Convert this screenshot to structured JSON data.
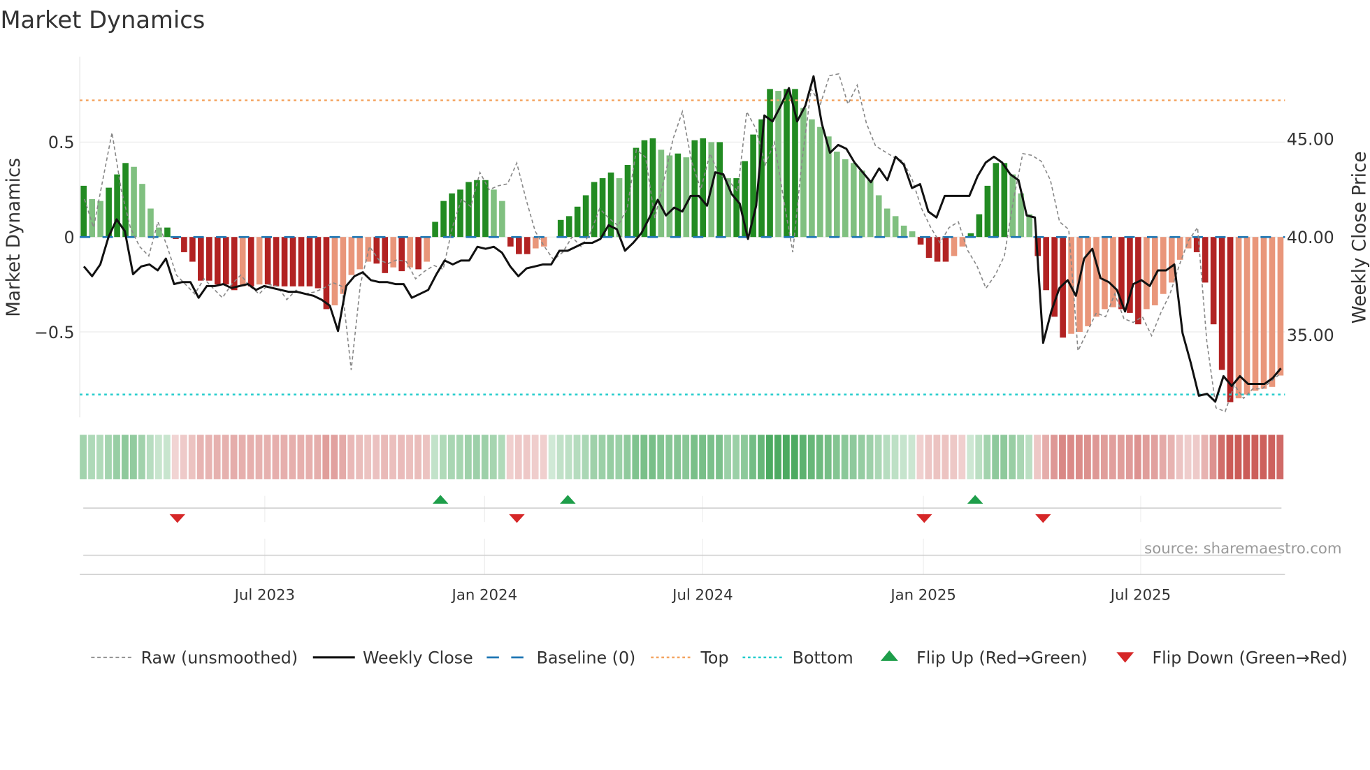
{
  "chart_data": {
    "type": "bar+line",
    "title": "Market Dynamics",
    "ylabel_left": "Market Dynamics",
    "ylabel_right": "Weekly Close Price",
    "ylim_left": [
      -0.95,
      0.95
    ],
    "ylim_right": [
      30.8,
      49.2
    ],
    "xlim_weeks": [
      0,
      142
    ],
    "left_ticks": [
      {
        "v": 0.5,
        "label": "0.5"
      },
      {
        "v": 0,
        "label": "0"
      },
      {
        "v": -0.5,
        "label": "−0.5"
      }
    ],
    "right_ticks": [
      {
        "v": 45,
        "label": "45.00"
      },
      {
        "v": 40,
        "label": "40.00"
      },
      {
        "v": 35,
        "label": "35.00"
      }
    ],
    "x_ticks": [
      {
        "week": 21.8,
        "label": "Jul 2023"
      },
      {
        "week": 47.7,
        "label": "Jan 2024"
      },
      {
        "week": 73.4,
        "label": "Jul 2024"
      },
      {
        "week": 99.4,
        "label": "Jan 2025"
      },
      {
        "week": 125.0,
        "label": "Jul 2025"
      }
    ],
    "top_level": 0.72,
    "bottom_level": -0.83,
    "baseline": 0,
    "momentum": [
      0.27,
      0.2,
      0.19,
      0.26,
      0.33,
      0.39,
      0.37,
      0.28,
      0.15,
      0.05,
      0.05,
      -0.01,
      -0.08,
      -0.13,
      -0.23,
      -0.23,
      -0.25,
      -0.25,
      -0.28,
      -0.26,
      -0.26,
      -0.25,
      -0.25,
      -0.26,
      -0.26,
      -0.26,
      -0.26,
      -0.26,
      -0.27,
      -0.38,
      -0.36,
      -0.3,
      -0.2,
      -0.17,
      -0.13,
      -0.14,
      -0.19,
      -0.16,
      -0.18,
      -0.16,
      -0.17,
      -0.13,
      0.08,
      0.19,
      0.23,
      0.25,
      0.29,
      0.3,
      0.3,
      0.25,
      0.19,
      -0.05,
      -0.09,
      -0.09,
      -0.06,
      -0.05,
      0.0,
      0.09,
      0.11,
      0.16,
      0.22,
      0.29,
      0.31,
      0.34,
      0.31,
      0.38,
      0.47,
      0.51,
      0.52,
      0.46,
      0.43,
      0.44,
      0.42,
      0.51,
      0.52,
      0.5,
      0.5,
      0.31,
      0.31,
      0.4,
      0.54,
      0.62,
      0.78,
      0.77,
      0.78,
      0.78,
      0.68,
      0.62,
      0.58,
      0.53,
      0.45,
      0.41,
      0.39,
      0.35,
      0.3,
      0.22,
      0.15,
      0.11,
      0.06,
      0.03,
      -0.04,
      -0.11,
      -0.13,
      -0.13,
      -0.1,
      -0.05,
      0.02,
      0.12,
      0.27,
      0.39,
      0.39,
      0.33,
      0.23,
      0.12,
      -0.1,
      -0.28,
      -0.42,
      -0.53,
      -0.51,
      -0.5,
      -0.47,
      -0.42,
      -0.38,
      -0.37,
      -0.38,
      -0.4,
      -0.46,
      -0.38,
      -0.36,
      -0.3,
      -0.24,
      -0.12,
      -0.06,
      -0.08,
      -0.24,
      -0.46,
      -0.7,
      -0.87,
      -0.85,
      -0.83,
      -0.81,
      -0.8,
      -0.79,
      -0.73
    ],
    "raw": [
      0.2,
      0.05,
      0.3,
      0.55,
      0.25,
      0.05,
      -0.05,
      -0.1,
      0.08,
      -0.05,
      -0.2,
      -0.25,
      -0.3,
      -0.22,
      -0.27,
      -0.32,
      -0.25,
      -0.2,
      -0.26,
      -0.3,
      -0.25,
      -0.26,
      -0.33,
      -0.28,
      -0.3,
      -0.29,
      -0.27,
      -0.24,
      -0.26,
      -0.7,
      -0.25,
      -0.05,
      -0.12,
      -0.14,
      -0.12,
      -0.13,
      -0.22,
      -0.18,
      -0.15,
      -0.17,
      0.05,
      0.2,
      0.16,
      0.34,
      0.25,
      0.27,
      0.28,
      0.39,
      0.2,
      0.03,
      -0.05,
      -0.12,
      -0.08,
      0.0,
      -0.05,
      0.02,
      0.15,
      0.1,
      0.06,
      0.15,
      0.46,
      0.42,
      0.1,
      0.3,
      0.52,
      0.66,
      0.4,
      0.25,
      0.44,
      0.33,
      0.3,
      0.24,
      0.66,
      0.57,
      0.38,
      0.5,
      0.2,
      -0.08,
      0.4,
      0.78,
      0.7,
      0.85,
      0.86,
      0.7,
      0.8,
      0.6,
      0.48,
      0.45,
      0.42,
      0.4,
      0.3,
      0.15,
      0.05,
      -0.03,
      0.05,
      0.08,
      -0.07,
      -0.15,
      -0.27,
      -0.2,
      -0.1,
      0.2,
      0.44,
      0.43,
      0.4,
      0.3,
      0.08,
      0.04,
      -0.6,
      -0.5,
      -0.4,
      -0.42,
      -0.3,
      -0.43,
      -0.45,
      -0.42,
      -0.52,
      -0.4,
      -0.3,
      -0.15,
      -0.02,
      0.05,
      -0.55,
      -0.9,
      -0.92,
      -0.78,
      -0.85,
      -0.8,
      -0.8,
      -0.76,
      -0.72
    ],
    "weekly_close": [
      38.5,
      38.0,
      38.6,
      40.0,
      40.9,
      40.3,
      38.1,
      38.5,
      38.6,
      38.3,
      38.9,
      37.6,
      37.7,
      37.7,
      36.9,
      37.5,
      37.5,
      37.6,
      37.4,
      37.5,
      37.6,
      37.3,
      37.5,
      37.4,
      37.3,
      37.2,
      37.2,
      37.1,
      37.0,
      36.8,
      36.5,
      35.2,
      37.5,
      38.0,
      38.2,
      37.8,
      37.7,
      37.7,
      37.6,
      37.6,
      36.9,
      37.1,
      37.3,
      38.1,
      38.8,
      38.6,
      38.8,
      38.8,
      39.5,
      39.4,
      39.5,
      39.2,
      38.5,
      38.0,
      38.4,
      38.5,
      38.6,
      38.6,
      39.3,
      39.3,
      39.5,
      39.7,
      39.7,
      39.9,
      40.6,
      40.4,
      39.3,
      39.7,
      40.2,
      41.0,
      41.9,
      41.1,
      41.5,
      41.3,
      42.1,
      42.1,
      41.6,
      43.3,
      43.2,
      42.2,
      41.7,
      39.9,
      41.6,
      46.2,
      45.9,
      46.7,
      47.6,
      45.9,
      46.7,
      48.2,
      45.8,
      44.3,
      44.7,
      44.5,
      43.8,
      43.3,
      42.8,
      43.5,
      42.9,
      44.1,
      43.7,
      42.5,
      42.7,
      41.3,
      41.0,
      42.1,
      42.1,
      42.1,
      42.1,
      43.1,
      43.8,
      44.1,
      43.8,
      43.2,
      42.9,
      41.1,
      41.0,
      34.6,
      36.2,
      37.4,
      37.8,
      37.0,
      38.9,
      39.4,
      37.9,
      37.7,
      37.3,
      36.2,
      37.6,
      37.8,
      37.5,
      38.3,
      38.3,
      38.6,
      35.1,
      33.6,
      31.9,
      32.0,
      31.6,
      32.9,
      32.4,
      32.9,
      32.5,
      32.5,
      32.5,
      32.8,
      33.3
    ],
    "flip_up_weeks": [
      42,
      57,
      105
    ],
    "flip_down_weeks": [
      11,
      51,
      99,
      113
    ],
    "colors": {
      "strong_up": "#228b22",
      "weak_up": "#80c080",
      "strong_down": "#b22222",
      "weak_down": "#e9967a",
      "close": "#111111",
      "raw": "#888888",
      "baseline": "#1f77b4",
      "top": "#f4a460",
      "bottom": "#22cccc",
      "flip_up": "#1e9e4a",
      "flip_down": "#d62728"
    },
    "legend": {
      "placement": "bottom",
      "items": [
        {
          "label": "Raw (unsmoothed)",
          "kind": "raw"
        },
        {
          "label": "Weekly Close",
          "kind": "close"
        },
        {
          "label": "Baseline (0)",
          "kind": "baseline"
        },
        {
          "label": "Top",
          "kind": "top"
        },
        {
          "label": "Bottom",
          "kind": "bottom"
        },
        {
          "label": "Flip Up (Red→Green)",
          "kind": "up"
        },
        {
          "label": "Flip Down (Green→Red)",
          "kind": "down"
        }
      ]
    },
    "source": "source: sharemaestro.com"
  }
}
